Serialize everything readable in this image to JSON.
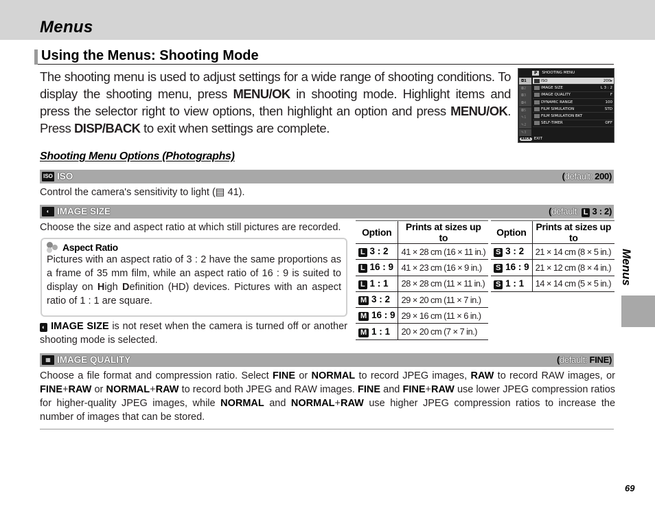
{
  "chapter_title": "Menus",
  "section_heading": "Using the Menus: Shooting Mode",
  "intro": {
    "t1": "The shooting menu is used to adjust settings for a wide range of shooting conditions.  To display the shooting menu, press ",
    "k1": "MENU/OK",
    "t2": " in shooting mode.  Highlight items and press the selector right to view options, then highlight an option and press ",
    "k2": "MENU/OK",
    "t3": ".  Press ",
    "k3": "DISP/BACK",
    "t4": " to exit when settings are complete."
  },
  "camera_screen": {
    "mode_badge": "P",
    "title": "SHOOTING MENU",
    "tabs": [
      "1",
      "2",
      "3",
      "4",
      "5",
      "1",
      "2",
      "3"
    ],
    "rows": [
      {
        "label": "ISO",
        "value": "200▸"
      },
      {
        "label": "IMAGE SIZE",
        "value": "L 3 : 2"
      },
      {
        "label": "IMAGE QUALITY",
        "value": "F"
      },
      {
        "label": "DYNAMIC RANGE",
        "value": "100"
      },
      {
        "label": "FILM SIMULATION",
        "value": "STD"
      },
      {
        "label": "FILM SIMULATION BKT",
        "value": ""
      },
      {
        "label": "SELF-TIMER",
        "value": "OFF"
      }
    ],
    "footer_button": "BACK",
    "footer_label": "EXIT"
  },
  "subheading": "Shooting Menu Options (Photographs)",
  "iso": {
    "icon": "ISO",
    "name": "ISO",
    "default_label": "default:",
    "default_value": "200",
    "description": "Control the camera's sensitivity to light (▤ 41)."
  },
  "image_size": {
    "name": "IMAGE SIZE",
    "default_label": "default:",
    "default_badge": "L",
    "default_value": "3 : 2",
    "description": "Choose the size and aspect ratio at which still pictures are recorded.",
    "table_headers": [
      "Option",
      "Prints at sizes up to"
    ],
    "table_left": [
      {
        "size": "L",
        "ratio": "3 : 2",
        "print": "41 × 28 cm (16 × 11 in.)"
      },
      {
        "size": "L",
        "ratio": "16 : 9",
        "print": "41 × 23 cm (16 × 9 in.)"
      },
      {
        "size": "L",
        "ratio": "1 : 1",
        "print": "28 × 28 cm (11 × 11 in.)"
      },
      {
        "size": "M",
        "ratio": "3 : 2",
        "print": "29 × 20 cm (11 × 7 in.)"
      },
      {
        "size": "M",
        "ratio": "16 : 9",
        "print": "29 × 16 cm (11 × 6 in.)"
      },
      {
        "size": "M",
        "ratio": "1 : 1",
        "print": "20 × 20 cm (7 × 7 in.)"
      }
    ],
    "table_right": [
      {
        "size": "S",
        "ratio": "3 : 2",
        "print": "21 × 14 cm (8 × 5 in.)"
      },
      {
        "size": "S",
        "ratio": "16 : 9",
        "print": "21 × 12 cm (8 × 4 in.)"
      },
      {
        "size": "S",
        "ratio": "1 : 1",
        "print": "14 × 14 cm (5 × 5 in.)"
      }
    ],
    "note_title": "Aspect Ratio",
    "note_text_1": "Pictures with an aspect ratio of 3 : 2 have the same proportions as a frame of 35 mm film, while an aspect ratio of 16 : 9 is suited to display on ",
    "note_H": "H",
    "note_text_2": "igh ",
    "note_D": "D",
    "note_text_3": "efinition (HD) devices.  Pictures with an aspect ratio of 1 : 1 are square.",
    "reset_bold": "IMAGE SIZE",
    "reset_text": " is not reset when the camera is turned off or another shooting mode is selected."
  },
  "image_quality": {
    "name": "IMAGE QUALITY",
    "default_label": "default:",
    "default_value": "FINE",
    "segments": [
      {
        "t": "Choose a file format and compression ratio.  Select ",
        "b": false
      },
      {
        "t": "FINE",
        "b": true
      },
      {
        "t": " or ",
        "b": false
      },
      {
        "t": "NORMAL",
        "b": true
      },
      {
        "t": " to record JPEG images, ",
        "b": false
      },
      {
        "t": "RAW",
        "b": true
      },
      {
        "t": " to record RAW images, or ",
        "b": false
      },
      {
        "t": "FINE",
        "b": true
      },
      {
        "t": "+",
        "b": false
      },
      {
        "t": "RAW",
        "b": true
      },
      {
        "t": " or ",
        "b": false
      },
      {
        "t": "NORMAL",
        "b": true
      },
      {
        "t": "+",
        "b": false
      },
      {
        "t": "RAW",
        "b": true
      },
      {
        "t": " to record both JPEG and RAW images.  ",
        "b": false
      },
      {
        "t": "FINE",
        "b": true
      },
      {
        "t": " and ",
        "b": false
      },
      {
        "t": "FINE",
        "b": true
      },
      {
        "t": "+",
        "b": false
      },
      {
        "t": "RAW",
        "b": true
      },
      {
        "t": " use lower JPEG compression ratios for higher-quality JPEG images, while ",
        "b": false
      },
      {
        "t": "NORMAL",
        "b": true
      },
      {
        "t": " and ",
        "b": false
      },
      {
        "t": "NORMAL",
        "b": true
      },
      {
        "t": "+",
        "b": false
      },
      {
        "t": "RAW",
        "b": true
      },
      {
        "t": " use higher JPEG compression ratios to increase the number of images that can be stored.",
        "b": false
      }
    ]
  },
  "side_tab_label": "Menus",
  "page_number": "69"
}
